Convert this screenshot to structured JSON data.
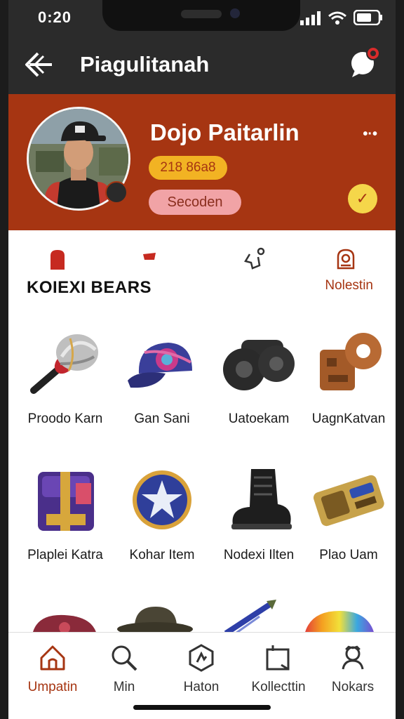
{
  "status": {
    "time": "0:20"
  },
  "header": {
    "title": "Piagulitanah"
  },
  "profile": {
    "name": "Dojo Paitarlin",
    "badge": "218 86a8",
    "tag": "Secoden"
  },
  "section": {
    "title": "KOIEXI BEARS",
    "link": "Nolestin"
  },
  "items": [
    {
      "label": "Proodo Karn",
      "icon": "hammer-icon"
    },
    {
      "label": "Gan Sani",
      "icon": "cap-icon"
    },
    {
      "label": "Uatoekam",
      "icon": "wheels-icon"
    },
    {
      "label": "UagnKatvan",
      "icon": "gadget-icon"
    },
    {
      "label": "Plaplei Katra",
      "icon": "chest-icon"
    },
    {
      "label": "Kohar Item",
      "icon": "star-coin-icon"
    },
    {
      "label": "Nodexi Ilten",
      "icon": "boot-icon"
    },
    {
      "label": "Plao Uam",
      "icon": "device-icon"
    }
  ],
  "nav": [
    {
      "label": "Umpatin",
      "icon": "home-icon"
    },
    {
      "label": "Min",
      "icon": "search-icon"
    },
    {
      "label": "Haton",
      "icon": "hexagon-icon"
    },
    {
      "label": "Kollecttin",
      "icon": "collection-icon"
    },
    {
      "label": "Nokars",
      "icon": "profile-icon"
    }
  ],
  "colors": {
    "accent": "#a63512",
    "header": "#2b2b2b",
    "badge": "#f2b323",
    "tag": "#f1a3a6"
  }
}
